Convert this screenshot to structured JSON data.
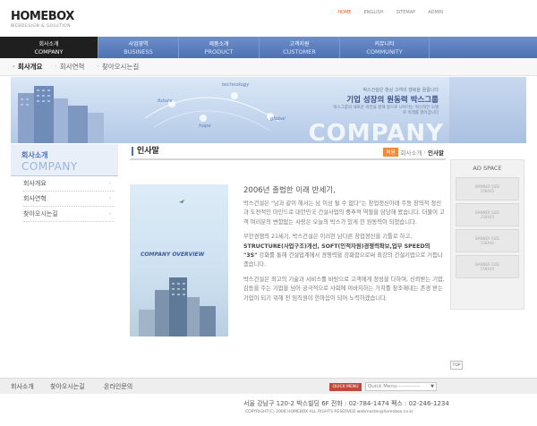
{
  "header": {
    "logo": "HOMEBOX",
    "logo_sub": "WEBDESIGN & SOLUTION",
    "util": [
      "HOME",
      "ENGLISH",
      "SITEMAP",
      "ADMIN"
    ]
  },
  "gnb": [
    {
      "ko": "회사소개",
      "en": "COMPANY"
    },
    {
      "ko": "사업영역",
      "en": "BUSINESS"
    },
    {
      "ko": "제품소개",
      "en": "PRODUCT"
    },
    {
      "ko": "고객지원",
      "en": "CUSTOMER"
    },
    {
      "ko": "커뮤니티",
      "en": "COMMUNITY"
    }
  ],
  "subnav": [
    "회사개요",
    "회사연혁",
    "찾아오시는길"
  ],
  "visual": {
    "words": [
      "future",
      "technology",
      "hope",
      "global"
    ],
    "copy1": "박스건설은 항상 고객의 행복을 꿈꿉니다",
    "copy2": "기업 성장의 원동력 박스그룹",
    "copy3": "박스그룹의 새로운 비전을 향해 앞으로 나아가는 혁신적인 모델로 미래를 열어갑니다",
    "company": "COMPANY"
  },
  "lnb": {
    "title_ko": "회사소개",
    "title_en": "COMPANY",
    "items": [
      "회사개요",
      "회사연혁",
      "찾아오시는길"
    ]
  },
  "content": {
    "title": "인사말",
    "crumb_home": "처음",
    "crumb_parent": "회사소개",
    "crumb_current": "인사말",
    "overview_label": "COMPANY OVERVIEW",
    "greet_title": "2006년 출범한 이래 반세기,",
    "para1": "박스건설은 \"남과 같이 해서는 남 이상 될 수 없다\"는 창업정신아래 주동 창의적 정신과 도전적인 마인드로 대한민국 건설사업의 중추적 역할을 담당해 왔습니다. 더불어 고객 여러분의 변함없는 사랑은 오늘의 박스가 있게 한 원동력이 되었습니다.",
    "para2_a": "무한경쟁의 21세기, 박스건설은 이러한 남다른 창업정신을 기틀로 하고,",
    "para2_b": "STRUCTURE(사업구조)개선, SOFT(인적자원)경쟁력확보,업무 SPEED의 \"3S\"",
    "para2_c": "강화를 통해 건설업계에서 경쟁력을 강화함으로써 최강의 건설기업으로 거듭나겠습니다.",
    "para3": "박스건설은 최고의 기술과 서비스를 바탕으로 고객에게 정성을 다하여, 신뢰받는 기업, 감동을 주는 기업을 넘어 궁극적으로 사회에 이바지하는 가치를 창조해내는 존경 받는 기업이 되기 위해 전 임직원이 한마음이 되어 노력하겠습니다."
  },
  "ad": {
    "title": "AD SPACE",
    "banner_line1": "BANNER SIZE",
    "banner_line2": "158X45"
  },
  "top_label": "TOP",
  "footer": {
    "nav": [
      "회사소개",
      "찾아오시는길",
      "온라인문의"
    ],
    "quickmenu_label": "QUICK MENU",
    "quickmenu_value": "Quick Menu-------------",
    "address": "서울 강남구 120-2 박스빌딩 6F   전화 : 02-784-1474   팩스 : 02-246-1234",
    "copyright": "COPYRIGHT(C) 2006 HOMEBOX ALL RIGHTS RESERVED    webmaster@homebox.co.kr"
  },
  "colors": {
    "gnb": "#5b7ebe",
    "gnb_active": "#1f1f1f",
    "accent": "#e0612a"
  }
}
